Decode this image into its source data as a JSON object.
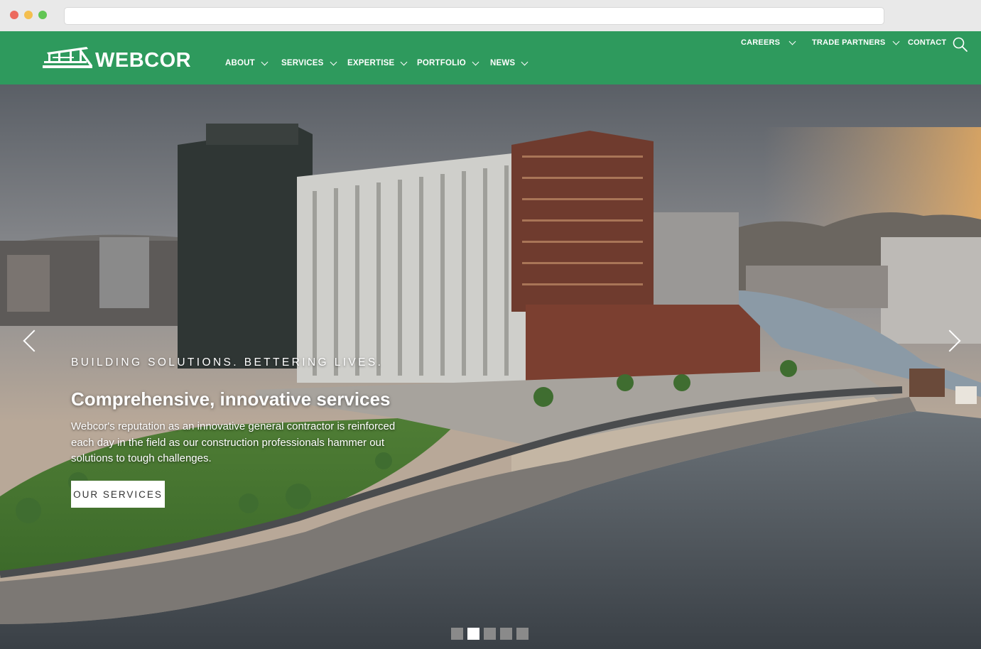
{
  "colors": {
    "brand_green": "#2e9a5d",
    "white": "#ffffff"
  },
  "browser": {
    "controls": [
      "close-dot",
      "minimize-dot",
      "maximize-dot"
    ]
  },
  "header": {
    "logo_text": "WEBCOR",
    "nav": [
      {
        "label": "ABOUT",
        "has_dropdown": true
      },
      {
        "label": "SERVICES",
        "has_dropdown": true
      },
      {
        "label": "EXPERTISE",
        "has_dropdown": true
      },
      {
        "label": "PORTFOLIO",
        "has_dropdown": true
      },
      {
        "label": "NEWS",
        "has_dropdown": true
      }
    ],
    "top_nav": [
      {
        "label": "CAREERS",
        "has_dropdown": true
      },
      {
        "label": "TRADE PARTNERS",
        "has_dropdown": true
      },
      {
        "label": "CONTACT",
        "has_dropdown": false
      }
    ],
    "search_icon": "search-icon"
  },
  "hero": {
    "tagline": "BUILDING SOLUTIONS. BETTERING LIVES.",
    "headline": "Comprehensive, innovative services",
    "description": "Webcor's reputation as an innovative general contractor is reinforced each day in the field as our construction professionals hammer out solutions to tough challenges.",
    "cta_label": "OUR SERVICES",
    "prev_icon": "chevron-left-icon",
    "next_icon": "chevron-right-icon",
    "slides_total": 5,
    "active_slide": 2
  }
}
